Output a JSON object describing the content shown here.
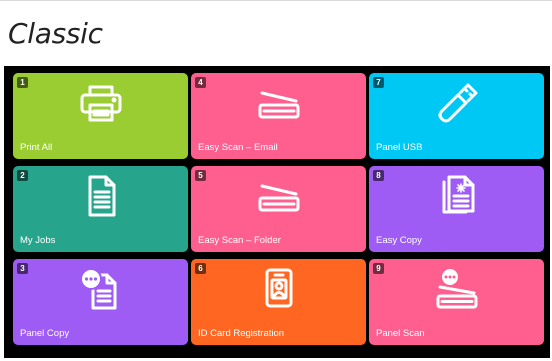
{
  "page_title": "Classic",
  "colors": {
    "green": "#9acd32",
    "pink": "#ff5f8f",
    "cyan": "#00c8f5",
    "teal": "#27a58c",
    "purple": "#9e5cf5",
    "orange": "#ff6622"
  },
  "tiles": [
    {
      "number": "1",
      "label": "Print All",
      "icon": "printer-icon"
    },
    {
      "number": "4",
      "label": "Easy Scan – Email",
      "icon": "scanner-icon"
    },
    {
      "number": "7",
      "label": "Panel USB",
      "icon": "usb-drive-icon"
    },
    {
      "number": "2",
      "label": "My Jobs",
      "icon": "document-icon"
    },
    {
      "number": "5",
      "label": "Easy Scan – Folder",
      "icon": "scanner-icon"
    },
    {
      "number": "8",
      "label": "Easy Copy",
      "icon": "copy-documents-icon"
    },
    {
      "number": "3",
      "label": "Panel Copy",
      "icon": "document-with-more-icon"
    },
    {
      "number": "6",
      "label": "ID Card Registration",
      "icon": "id-badge-icon"
    },
    {
      "number": "9",
      "label": "Panel Scan",
      "icon": "scanner-with-more-icon"
    }
  ]
}
